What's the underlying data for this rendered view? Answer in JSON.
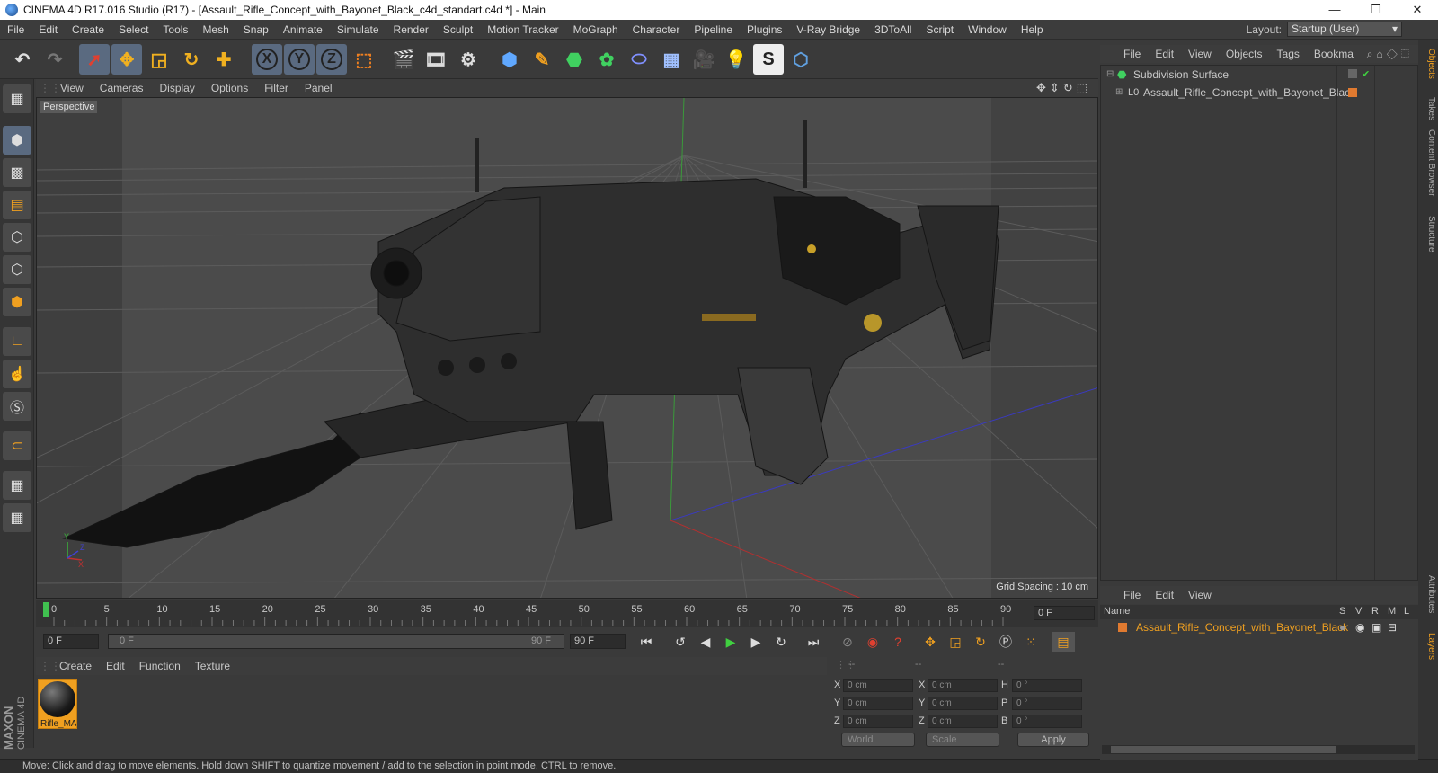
{
  "window": {
    "title": "CINEMA 4D R17.016 Studio (R17) - [Assault_Rifle_Concept_with_Bayonet_Black_c4d_standart.c4d *] - Main",
    "minimize": "—",
    "restore": "❐",
    "close": "✕"
  },
  "menu": [
    "File",
    "Edit",
    "Create",
    "Select",
    "Tools",
    "Mesh",
    "Snap",
    "Animate",
    "Simulate",
    "Render",
    "Sculpt",
    "Motion Tracker",
    "MoGraph",
    "Character",
    "Pipeline",
    "Plugins",
    "V-Ray Bridge",
    "3DToAll",
    "Script",
    "Window",
    "Help"
  ],
  "layout": {
    "label": "Layout:",
    "value": "Startup (User)"
  },
  "toolbar": {
    "x_label": "X",
    "y_label": "Y",
    "z_label": "Z"
  },
  "viewport": {
    "menu": [
      "View",
      "Cameras",
      "Display",
      "Options",
      "Filter",
      "Panel"
    ],
    "camera": "Perspective",
    "grid_spacing": "Grid Spacing : 10 cm",
    "axis_x": "X",
    "axis_y": "Y",
    "axis_z": "Z"
  },
  "timeline": {
    "ticks": [
      "0",
      "5",
      "10",
      "15",
      "20",
      "25",
      "30",
      "35",
      "40",
      "45",
      "50",
      "55",
      "60",
      "65",
      "70",
      "75",
      "80",
      "85",
      "90"
    ],
    "current_frame": "0 F"
  },
  "playback": {
    "start": "0 F",
    "range_start": "0 F",
    "range_end": "90 F",
    "end": "90 F"
  },
  "material_manager": {
    "menu": [
      "Create",
      "Edit",
      "Function",
      "Texture"
    ],
    "material_name": "Rifle_MA"
  },
  "coordinates": {
    "headers": [
      "--",
      "--",
      "--"
    ],
    "rows": [
      {
        "a": "X",
        "av": "0 cm",
        "b": "X",
        "bv": "0 cm",
        "c": "H",
        "cv": "0 °"
      },
      {
        "a": "Y",
        "av": "0 cm",
        "b": "Y",
        "bv": "0 cm",
        "c": "P",
        "cv": "0 °"
      },
      {
        "a": "Z",
        "av": "0 cm",
        "b": "Z",
        "bv": "0 cm",
        "c": "B",
        "cv": "0 °"
      }
    ],
    "space": "World",
    "mode": "Scale",
    "apply": "Apply"
  },
  "status": "Move: Click and drag to move elements. Hold down SHIFT to quantize movement / add to the selection in point mode, CTRL to remove.",
  "brand": {
    "line1": "MAXON",
    "line2": "CINEMA 4D"
  },
  "objects": {
    "menu": [
      "File",
      "Edit",
      "View",
      "Objects",
      "Tags",
      "Bookma"
    ],
    "items": [
      {
        "name": "Subdivision Surface"
      },
      {
        "name": "Assault_Rifle_Concept_with_Bayonet_Black"
      }
    ]
  },
  "layers": {
    "menu": [
      "File",
      "Edit",
      "View"
    ],
    "col_name": "Name",
    "cols": [
      "S",
      "V",
      "R",
      "M",
      "L"
    ],
    "row_name": "Assault_Rifle_Concept_with_Bayonet_Black"
  },
  "right_tabs": [
    "Objects",
    "Takes",
    "Content Browser",
    "Structure",
    "Attributes",
    "Layers"
  ],
  "colors": {
    "accent": "#f0a020",
    "selection": "#5a6a80",
    "layer": "#e07a30"
  }
}
